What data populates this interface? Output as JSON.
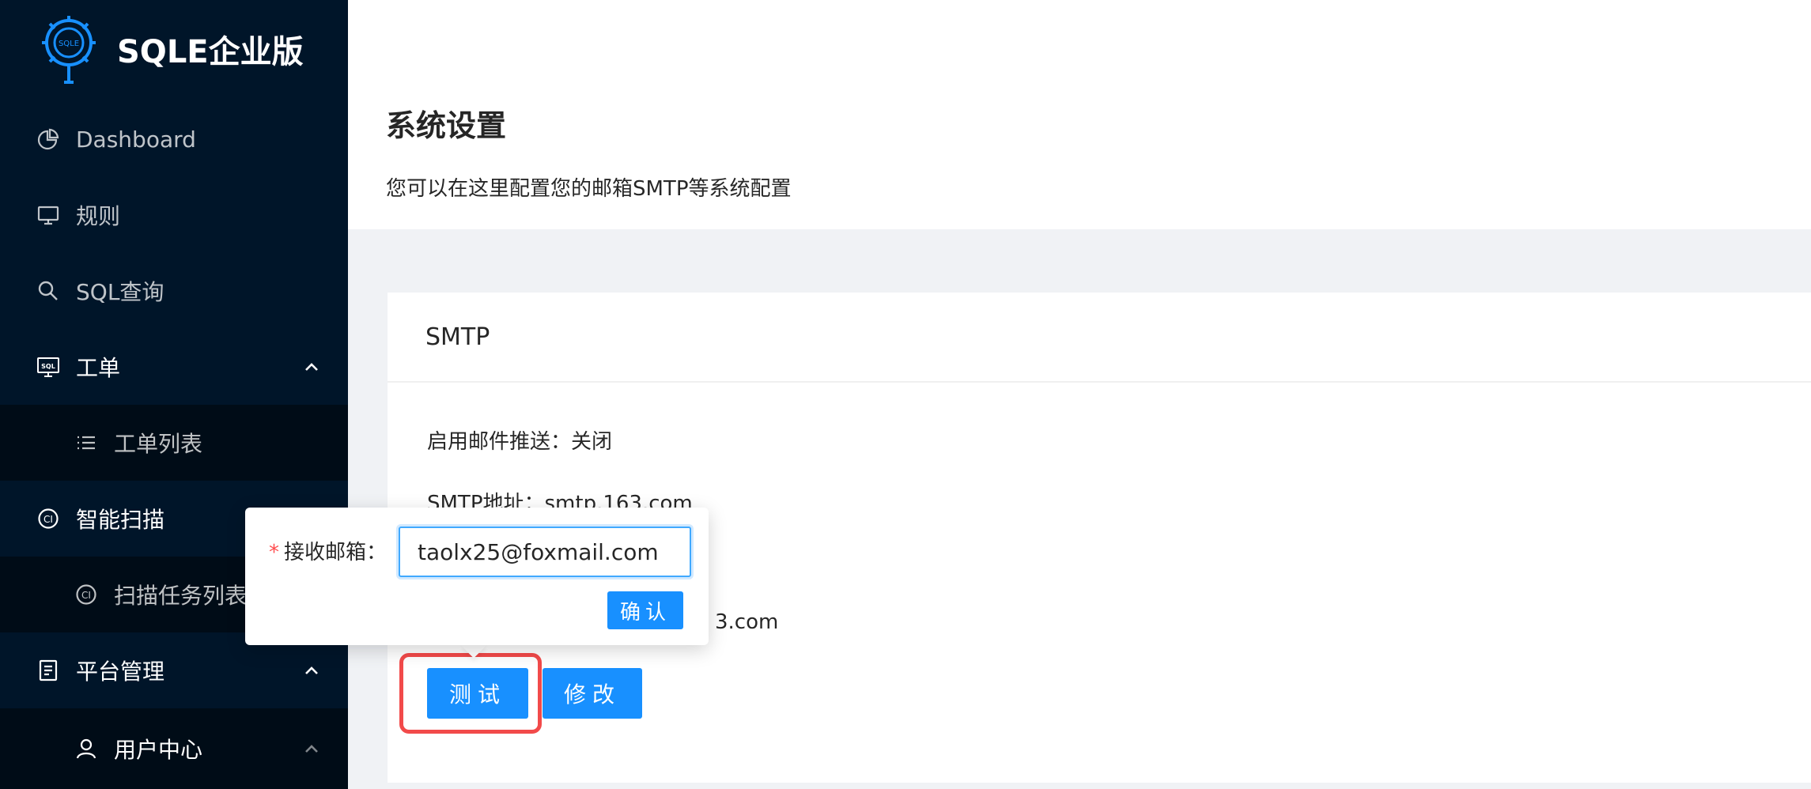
{
  "app": {
    "logo_text": "SQLE企业版",
    "logo_mark_text": "SQLE"
  },
  "sidebar": {
    "items": [
      {
        "label": "Dashboard",
        "icon": "pie-chart-icon"
      },
      {
        "label": "规则",
        "icon": "desktop-icon"
      },
      {
        "label": "SQL查询",
        "icon": "search-icon"
      },
      {
        "label": "工单",
        "icon": "sql-icon",
        "expanded": true
      },
      {
        "label": "工单列表",
        "icon": "list-icon",
        "sub": true
      },
      {
        "label": "智能扫描",
        "icon": "ci-icon"
      },
      {
        "label": "扫描任务列表",
        "icon": "ci-icon",
        "sub": true
      },
      {
        "label": "平台管理",
        "icon": "document-icon",
        "expanded": true
      },
      {
        "label": "用户中心",
        "icon": "user-icon",
        "sub": true
      }
    ]
  },
  "page": {
    "title": "系统设置",
    "description": "您可以在这里配置您的邮箱SMTP等系统配置"
  },
  "smtp_card": {
    "title": "SMTP",
    "enable_push": "启用邮件推送：关闭",
    "smtp_address": "SMTP地址：smtp.163.com",
    "partial_email": "3.com",
    "test_label": "测试",
    "edit_label": "修改"
  },
  "popover": {
    "label": "接收邮箱：",
    "required_mark": "*",
    "input_value": "taolx25@foxmail.com",
    "confirm_label": "确认"
  },
  "colors": {
    "sidebar_bg": "#001529",
    "primary": "#1890ff",
    "highlight": "#f24a4a"
  }
}
